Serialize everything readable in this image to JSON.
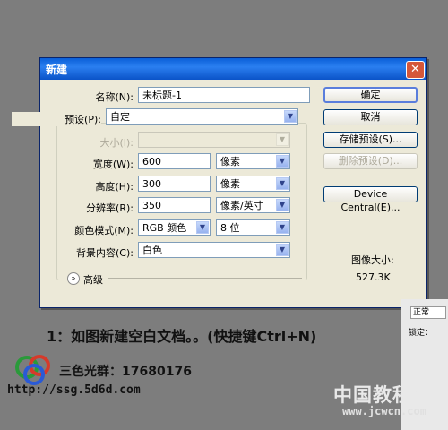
{
  "dialog": {
    "title": "新建",
    "name_label": "名称(N):",
    "name_value": "未标题-1",
    "preset_label": "预设(P):",
    "preset_value": "自定",
    "size_label": "大小(I):",
    "size_value": "",
    "width_label": "宽度(W):",
    "width_value": "600",
    "width_unit": "像素",
    "height_label": "高度(H):",
    "height_value": "300",
    "height_unit": "像素",
    "resolution_label": "分辨率(R):",
    "resolution_value": "350",
    "resolution_unit": "像素/英寸",
    "color_mode_label": "颜色模式(M):",
    "color_mode_value": "RGB 颜色",
    "bit_depth_value": "8 位",
    "background_label": "背景内容(C):",
    "background_value": "白色",
    "advanced_label": "高级",
    "buttons": {
      "ok": "确定",
      "cancel": "取消",
      "save_preset": "存储预设(S)...",
      "delete_preset": "删除预设(D)...",
      "device_central": "Device Central(E)..."
    },
    "image_size_label": "图像大小:",
    "image_size_value": "527.3K"
  },
  "instruction": "1：如图新建空白文档。。(快捷键Ctrl+N)",
  "group_info": "三色光群：17680176",
  "site_url": "http://ssg.5d6d.com",
  "watermark": "中国教程网",
  "watermark_url": "www.jcwcn.com",
  "panel_items": [
    "正常",
    "锁定："
  ],
  "colors": {
    "title_bar": "#0a5fd8",
    "dialog_bg": "#ece9d8",
    "desktop": "#7d7d7d"
  }
}
